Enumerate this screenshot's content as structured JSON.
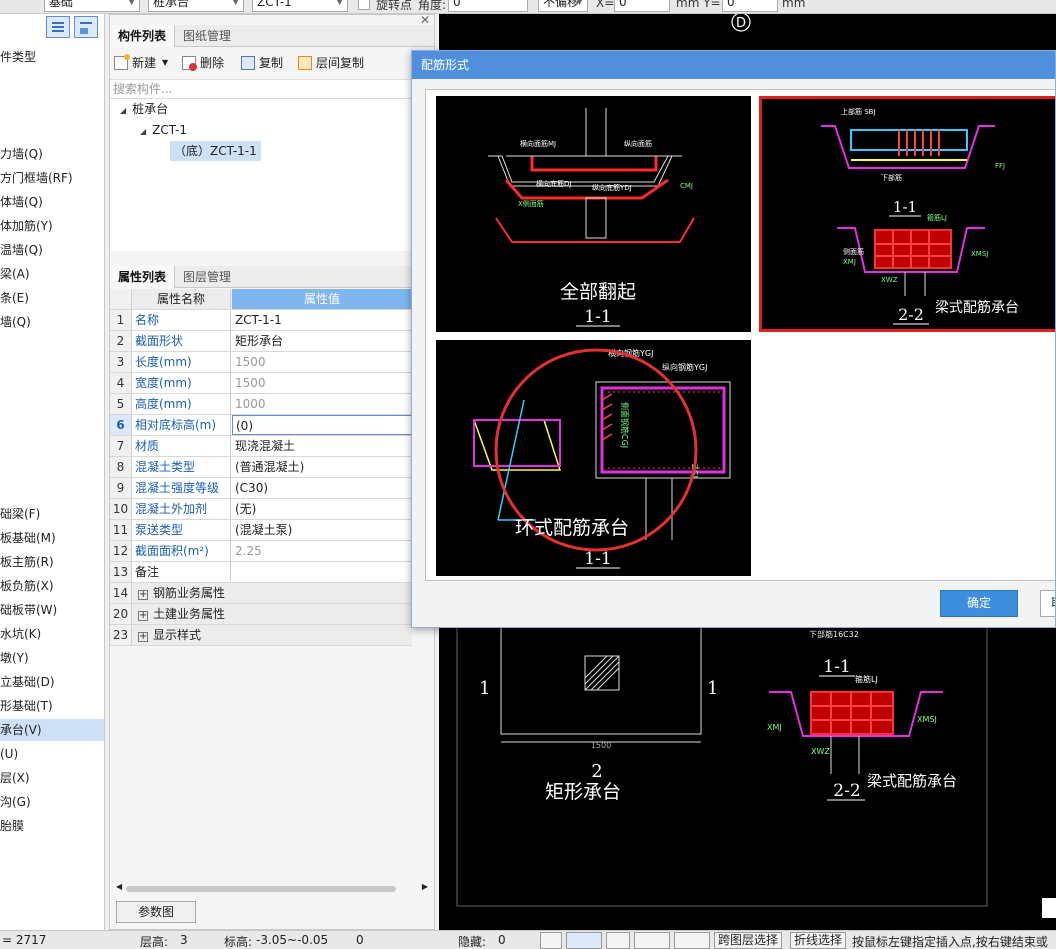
{
  "toolbar": {
    "combo1": "基础",
    "combo2": "桩承台",
    "combo3": "ZCT-1",
    "rotate_point": "旋转点",
    "angle_label": "角度:",
    "angle_value": "0",
    "offset_mode": "不偏移",
    "x_label": "X=",
    "x_value": "0",
    "y_label": "mm Y=",
    "y_value": "0",
    "unit": "mm"
  },
  "left_nav": {
    "items": [
      "件类型",
      "力墙(Q)",
      "方门框墙(RF)",
      "体墙(Q)",
      "体加筋(Y)",
      "温墙(Q)",
      "梁(A)",
      "条(E)",
      "墙(Q)",
      "础梁(F)",
      "板基础(M)",
      "板主筋(R)",
      "板负筋(X)",
      "础板带(W)",
      "水坑(K)",
      "墩(Y)",
      "立基础(D)",
      "形基础(T)",
      "承台(V)",
      "(U)",
      "层(X)",
      "沟(G)",
      "胎膜"
    ],
    "selected": "承台(V)"
  },
  "component_panel": {
    "tabs": [
      "构件列表",
      "图纸管理"
    ],
    "buttons": {
      "new": "新建",
      "delete": "删除",
      "copy": "复制",
      "floor_copy": "层间复制"
    },
    "search_placeholder": "搜索构件...",
    "tree": {
      "root": "桩承台",
      "child": "ZCT-1",
      "leaf": "（底）ZCT-1-1"
    }
  },
  "property_panel": {
    "tabs": [
      "属性列表",
      "图层管理"
    ],
    "header": {
      "name": "属性名称",
      "value": "属性值"
    },
    "rows": [
      {
        "num": "1",
        "name": "名称",
        "value": "ZCT-1-1"
      },
      {
        "num": "2",
        "name": "截面形状",
        "value": "矩形承台"
      },
      {
        "num": "3",
        "name": "长度(mm)",
        "value": "1500"
      },
      {
        "num": "4",
        "name": "宽度(mm)",
        "value": "1500"
      },
      {
        "num": "5",
        "name": "高度(mm)",
        "value": "1000"
      },
      {
        "num": "6",
        "name": "相对底标高(m)",
        "value": "(0)"
      },
      {
        "num": "7",
        "name": "材质",
        "value": "现浇混凝土"
      },
      {
        "num": "8",
        "name": "混凝土类型",
        "value": "(普通混凝土)"
      },
      {
        "num": "9",
        "name": "混凝土强度等级",
        "value": "(C30)"
      },
      {
        "num": "10",
        "name": "混凝土外加剂",
        "value": "(无)"
      },
      {
        "num": "11",
        "name": "泵送类型",
        "value": "(混凝土泵)"
      },
      {
        "num": "12",
        "name": "截面面积(m²)",
        "value": "2.25"
      },
      {
        "num": "13",
        "name": "备注",
        "value": ""
      }
    ],
    "groups": [
      {
        "num": "14",
        "name": "钢筋业务属性"
      },
      {
        "num": "20",
        "name": "土建业务属性"
      },
      {
        "num": "23",
        "name": "显示样式"
      }
    ],
    "params_button": "参数图"
  },
  "dialog": {
    "title": "配筋形式",
    "ok": "确定",
    "cancel": "取消",
    "options": [
      {
        "caption": "全部翻起",
        "section": "1-1",
        "labels": [
          "横向面筋MJ",
          "纵向面筋",
          "横向底筋DJ",
          "纵向底筋YDJ",
          "CMJ",
          "X侧面筋"
        ]
      },
      {
        "caption": "梁式配筋承台",
        "section": "2-2",
        "section_top": "1-1",
        "labels": [
          "上部筋 SBJ",
          "下部筋",
          "箍筋LJ",
          "XMSJ",
          "FFJ",
          "XMJ",
          "XWZ",
          "侧面筋"
        ]
      },
      {
        "caption": "环式配筋承台",
        "section": "1-1",
        "labels": [
          "横向钢筋YGJ",
          "纵向钢筋YGJ",
          "侧面钢筋CGJ",
          "ZGJ"
        ]
      }
    ]
  },
  "cad_background": {
    "axis_label": "D",
    "left_caption": "矩形承台",
    "left_section_num": "2",
    "left_marks": [
      "1",
      "1"
    ],
    "dim_1500": "1500",
    "right_caption": "梁式配筋承台",
    "right_section_top": "1-1",
    "right_section": "2-2",
    "right_labels": [
      "下部筋16C32",
      "箍筋LJ",
      "XMSJ",
      "XMJ",
      "XWZ"
    ]
  },
  "status_bar": {
    "coord": "= 2717",
    "floor_label": "层高:",
    "floor_value": "3",
    "elev_label": "标高:",
    "elev_value": "-3.05~-0.05",
    "zero": "0",
    "hidden_label": "隐藏:",
    "hidden_value": "0",
    "cross_floor": "跨图层选择",
    "polyline": "折线选择",
    "hint": "按鼠标左键指定插入点,按右键结束或"
  }
}
